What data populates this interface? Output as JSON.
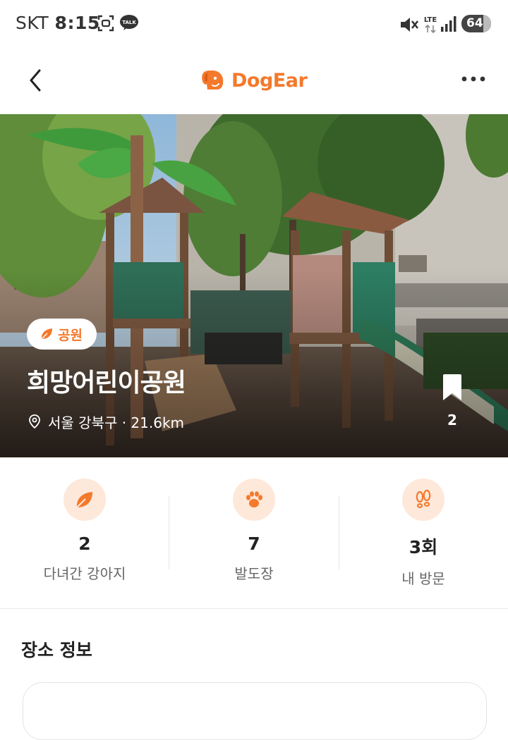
{
  "status_bar": {
    "carrier": "SKT",
    "time": "8:15",
    "talk_label": "TALK",
    "network": "LTE",
    "battery": "64"
  },
  "app_bar": {
    "brand": "DogEar"
  },
  "place": {
    "category": "공원",
    "name": "희망어린이공원",
    "location": "서울 강북구 · 21.6km",
    "bookmark_count": "2"
  },
  "stats": [
    {
      "value": "2",
      "label": "다녀간 강아지",
      "icon": "leaf-icon"
    },
    {
      "value": "7",
      "label": "발도장",
      "icon": "paw-icon"
    },
    {
      "value": "3회",
      "label": "내 방문",
      "icon": "footprints-icon"
    }
  ],
  "section": {
    "title": "장소 정보"
  },
  "colors": {
    "brand": "#f4792c",
    "icon_bg": "#fde8da"
  }
}
